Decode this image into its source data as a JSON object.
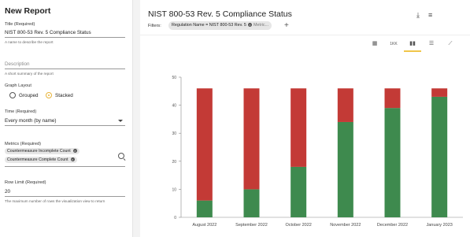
{
  "report": {
    "heading": "New Report",
    "title_label": "Title (Required)",
    "title_value": "NIST 800-53 Rev. 5 Compliance Status",
    "title_hint": "A name to describe the report",
    "description_placeholder": "Description",
    "description_hint": "A short summary of the report",
    "graph_layout_label": "Graph Layout",
    "layout_options": [
      "Grouped",
      "Stacked"
    ],
    "layout_selected": "Stacked",
    "time_label": "Time (Required)",
    "time_value": "Every month (by name)",
    "metrics_label": "Metrics (Required)",
    "metrics": [
      "Countermeasure Incomplete Count",
      "Countermeasure Complete Count"
    ],
    "row_limit_label": "Row Limit (Required)",
    "row_limit_value": "20",
    "row_limit_hint": "The maximum number of rows the visualization view to return"
  },
  "visualization": {
    "title": "NIST 800-53 Rev. 5 Compliance Status",
    "filters_label": "Filters:",
    "filter_chip": "Regulation Name = NIST 800-53 Rev. 5",
    "filter_metrics_placeholder": "Metric...",
    "view_types": [
      "table-icon",
      "number-icon",
      "column-chart-icon",
      "bar-chart-icon",
      "line-chart-icon"
    ],
    "active_view": "column-chart-icon",
    "number_view_label": "1KK"
  },
  "chart_data": {
    "type": "bar",
    "stacked": true,
    "categories": [
      "August 2022",
      "September 2022",
      "October 2022",
      "November 2022",
      "December 2022",
      "January 2023"
    ],
    "series": [
      {
        "color": "#3e8a4e",
        "values": [
          6,
          10,
          18,
          34,
          39,
          43
        ]
      },
      {
        "color": "#c33a36",
        "values": [
          40,
          36,
          28,
          12,
          7,
          3
        ]
      }
    ],
    "ylim": [
      0,
      50
    ],
    "yticks": [
      0,
      10,
      20,
      30,
      40,
      50
    ],
    "grid": false
  }
}
